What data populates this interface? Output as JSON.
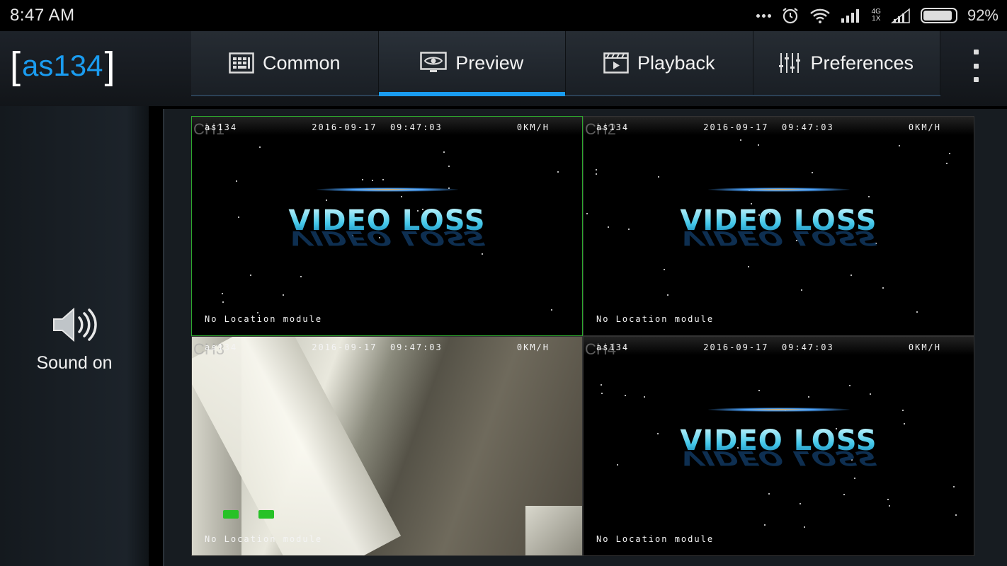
{
  "status_bar": {
    "time": "8:47 AM",
    "network_type": "4G",
    "network_sub": "1X",
    "battery_percent": "92%",
    "battery_level": 0.92
  },
  "app": {
    "logo_bracket_left": "[",
    "logo_text": "as134",
    "logo_bracket_right": "]",
    "accent_color": "#1a9cf0"
  },
  "tabs": [
    {
      "label": "Common",
      "icon": "grid-keypad-icon",
      "active": false
    },
    {
      "label": "Preview",
      "icon": "eye-monitor-icon",
      "active": true
    },
    {
      "label": "Playback",
      "icon": "film-play-icon",
      "active": false
    },
    {
      "label": "Preferences",
      "icon": "sliders-icon",
      "active": false
    }
  ],
  "left_panel": {
    "sound_label": "Sound on",
    "sound_icon": "speaker-icon"
  },
  "channels": [
    {
      "label": "CH1",
      "device": "as134",
      "date": "2016-09-17",
      "time": "09:47:03",
      "speed": "0KM/H",
      "footer": "No Location module",
      "state": "video-loss",
      "video_loss_text": "VIDEO LOSS",
      "selected": true
    },
    {
      "label": "CH2",
      "device": "as134",
      "date": "2016-09-17",
      "time": "09:47:03",
      "speed": "0KM/H",
      "footer": "No Location module",
      "state": "video-loss",
      "video_loss_text": "VIDEO LOSS",
      "selected": false
    },
    {
      "label": "CH3",
      "device": "as134",
      "date": "2016-09-17",
      "time": "09:47:03",
      "speed": "0KM/H",
      "footer": "No Location module",
      "state": "live",
      "video_loss_text": "",
      "selected": false
    },
    {
      "label": "CH4",
      "device": "as134",
      "date": "2016-09-17",
      "time": "09:47:03",
      "speed": "0KM/H",
      "footer": "No Location module",
      "state": "video-loss",
      "video_loss_text": "VIDEO LOSS",
      "selected": false
    }
  ]
}
